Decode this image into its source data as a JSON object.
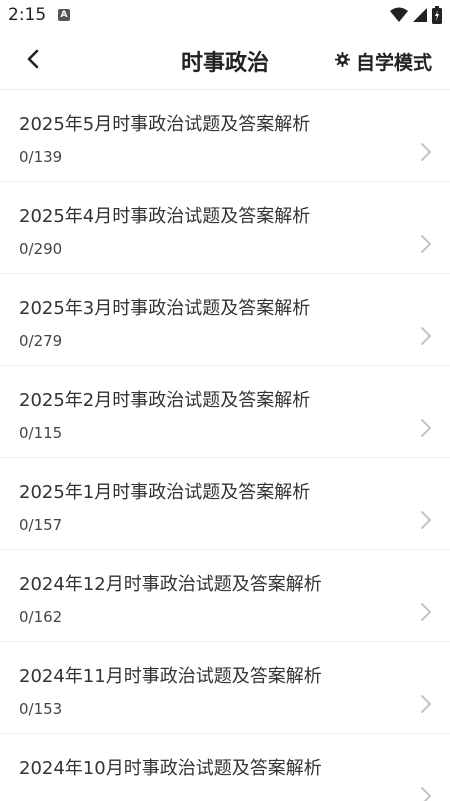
{
  "status_bar": {
    "time": "2:15",
    "notification_icon": "A",
    "icons": [
      "wifi-icon",
      "signal-icon",
      "battery-icon"
    ]
  },
  "header": {
    "title": "时事政治",
    "mode_label": "自学模式",
    "mode_icon": "gear-icon",
    "back_icon": "chevron-left-icon"
  },
  "items": [
    {
      "title": "2025年5月时事政治试题及答案解析",
      "count": "0/139"
    },
    {
      "title": "2025年4月时事政治试题及答案解析",
      "count": "0/290"
    },
    {
      "title": "2025年3月时事政治试题及答案解析",
      "count": "0/279"
    },
    {
      "title": "2025年2月时事政治试题及答案解析",
      "count": "0/115"
    },
    {
      "title": "2025年1月时事政治试题及答案解析",
      "count": "0/157"
    },
    {
      "title": "2024年12月时事政治试题及答案解析",
      "count": "0/162"
    },
    {
      "title": "2024年11月时事政治试题及答案解析",
      "count": "0/153"
    },
    {
      "title": "2024年10月时事政治试题及答案解析",
      "count": ""
    }
  ]
}
